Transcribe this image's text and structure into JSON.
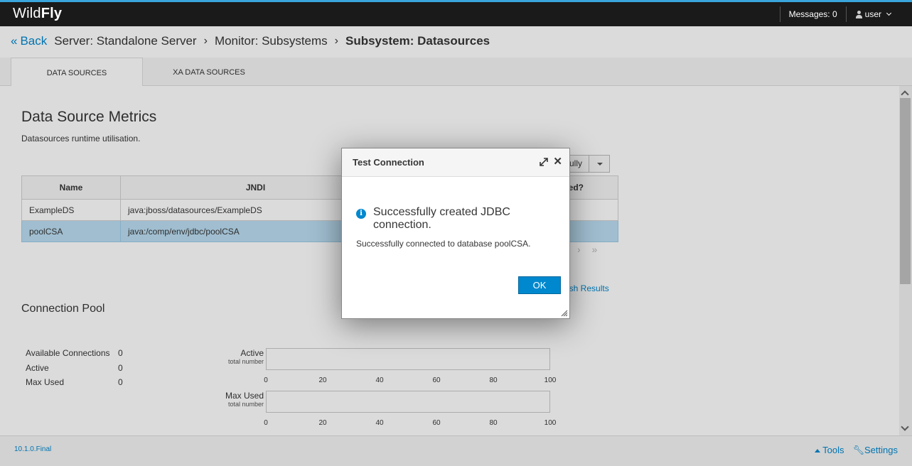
{
  "brand": {
    "light": "Wild",
    "bold": "Fly"
  },
  "topnav": {
    "messages": "Messages: 0",
    "user": "user"
  },
  "breadcrumb": {
    "back": "Back",
    "items": [
      "Server: Standalone Server",
      "Monitor: Subsystems"
    ],
    "current": "Subsystem: Datasources"
  },
  "tabs": [
    "DATA SOURCES",
    "XA DATA SOURCES"
  ],
  "metrics": {
    "title": "Data Source Metrics",
    "description": "Datasources runtime utilisation.",
    "filter_label": "ully",
    "columns": [
      "Name",
      "JNDI",
      "ed?"
    ],
    "rows": [
      {
        "name": "ExampleDS",
        "jndi": "java:jboss/datasources/ExampleDS"
      },
      {
        "name": "poolCSA",
        "jndi": "java:/comp/env/jdbc/poolCSA"
      }
    ],
    "pager": "› »",
    "refresh": "resh Results"
  },
  "pool": {
    "title": "Connection Pool",
    "stats": [
      {
        "label": "Available Connections",
        "value": "0"
      },
      {
        "label": "Active",
        "value": "0"
      },
      {
        "label": "Max Used",
        "value": "0"
      }
    ],
    "bars": [
      {
        "label": "Active",
        "sub": "total number",
        "value": 0
      },
      {
        "label": "Max Used",
        "sub": "total number",
        "value": 0
      }
    ],
    "ticks": [
      "0",
      "20",
      "40",
      "60",
      "80",
      "100"
    ]
  },
  "footer": {
    "version": "10.1.0.Final",
    "tools": "Tools",
    "settings": "Settings"
  },
  "modal": {
    "title": "Test Connection",
    "message": "Successfully created JDBC connection.",
    "detail": "Successfully connected to database poolCSA.",
    "ok": "OK"
  },
  "colors": {
    "accent": "#0088ce",
    "topbar": "#1a1a1a",
    "selected_row": "#bbdef3"
  }
}
